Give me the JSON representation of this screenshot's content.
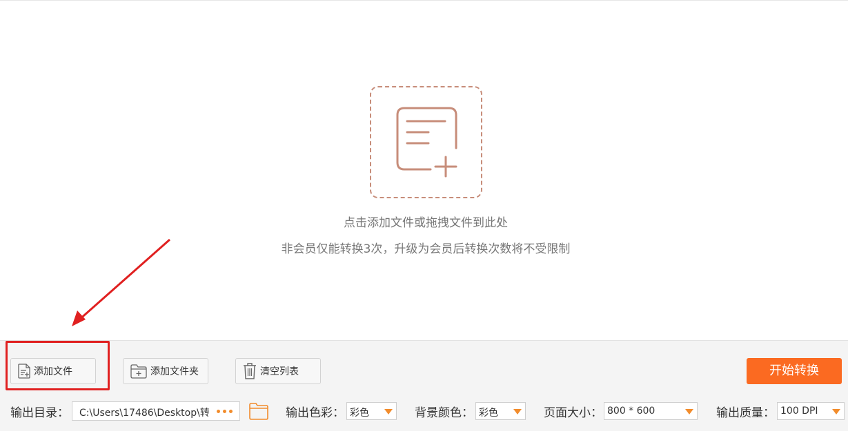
{
  "drop": {
    "hint_primary": "点击添加文件或拖拽文件到此处",
    "hint_secondary": "非会员仅能转换3次，升级为会员后转换次数将不受限制"
  },
  "toolbar": {
    "add_file_label": "添加文件",
    "add_folder_label": "添加文件夹",
    "clear_list_label": "清空列表",
    "start_label": "开始转换"
  },
  "settings": {
    "output_dir_label": "输出目录：",
    "output_dir_value": "C:\\Users\\17486\\Desktop\\转",
    "color_label": "输出色彩：",
    "color_value": "彩色",
    "bg_color_label": "背景颜色：",
    "bg_color_value": "彩色",
    "page_size_label": "页面大小：",
    "page_size_value": "800 * 600",
    "quality_label": "输出质量：",
    "quality_value": "100 DPI"
  },
  "colors": {
    "accent": "#fb6a21",
    "icon_brown": "#c78d7a",
    "highlight_red": "#e02020",
    "caret_orange": "#f28c2c"
  }
}
